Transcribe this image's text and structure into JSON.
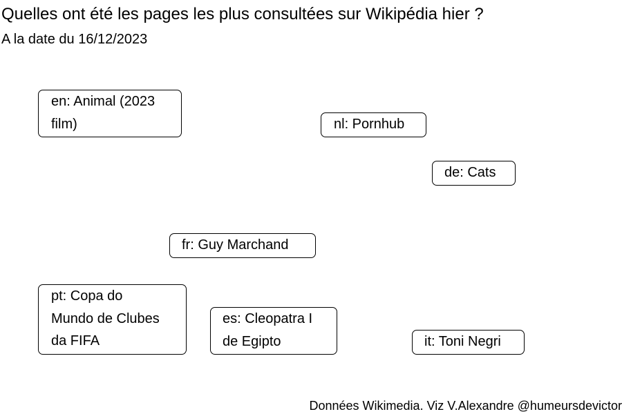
{
  "chart_data": {
    "type": "other",
    "title": "Quelles ont été les pages les plus consultées sur Wikipédia hier ?",
    "subtitle": "A la date du 16/12/2023",
    "caption": "Données Wikimedia. Viz V.Alexandre @humeursdevictor",
    "labels": [
      {
        "lang": "en",
        "page": "Animal (2023 film)",
        "lines": [
          "en: Animal (2023",
          "film)"
        ]
      },
      {
        "lang": "nl",
        "page": "Pornhub",
        "lines": [
          "nl: Pornhub"
        ]
      },
      {
        "lang": "de",
        "page": "Cats",
        "lines": [
          "de: Cats"
        ]
      },
      {
        "lang": "fr",
        "page": "Guy Marchand",
        "lines": [
          "fr: Guy Marchand"
        ]
      },
      {
        "lang": "pt",
        "page": "Copa do Mundo de Clubes da FIFA",
        "lines": [
          "pt: Copa do",
          "Mundo de Clubes",
          "da FIFA"
        ]
      },
      {
        "lang": "es",
        "page": "Cleopatra I de Egipto",
        "lines": [
          "es: Cleopatra I",
          "de Egipto"
        ]
      },
      {
        "lang": "it",
        "page": "Toni Negri",
        "lines": [
          "it: Toni Negri"
        ]
      }
    ]
  }
}
